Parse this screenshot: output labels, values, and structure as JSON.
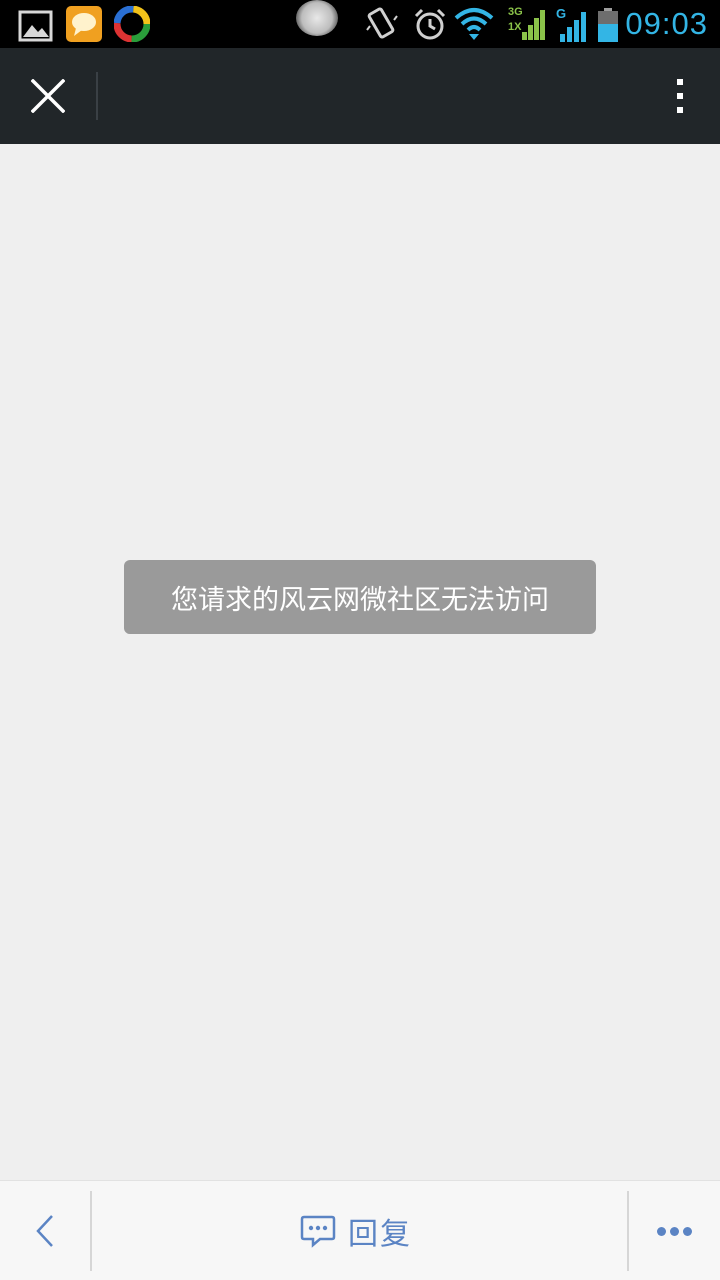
{
  "status_bar": {
    "time": "09:03",
    "network_type": "3G",
    "network_sub": "1X",
    "signal2_type": "G",
    "notification_icons": [
      "gallery-icon",
      "messaging-icon",
      "app-icon"
    ],
    "system_icons": [
      "vibrate-icon",
      "alarm-icon",
      "wifi-icon",
      "signal-icon",
      "battery-icon"
    ],
    "clock_color": "#33b5e5"
  },
  "app_bar": {
    "close_icon": "close-icon",
    "menu_icon": "overflow-menu-icon"
  },
  "toast": {
    "message": "您请求的风云网微社区无法访问"
  },
  "bottom_bar": {
    "back_icon": "chevron-left-icon",
    "reply_icon": "comment-icon",
    "reply_label": "回复",
    "more_icon": "more-dots-icon",
    "accent_color": "#5b84c4"
  }
}
